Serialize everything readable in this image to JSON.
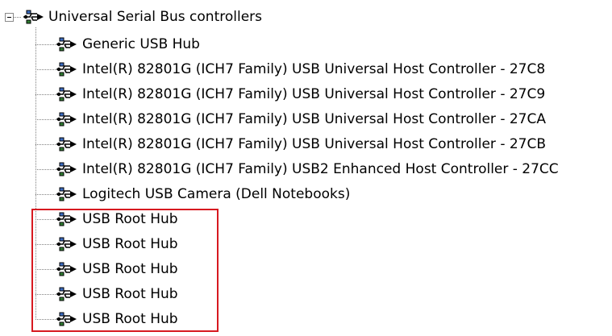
{
  "tree": {
    "root": {
      "label": "Universal Serial Bus controllers",
      "expanded": true,
      "icon": "usb-icon"
    },
    "children": [
      {
        "label": "Generic USB Hub",
        "icon": "usb-icon"
      },
      {
        "label": "Intel(R) 82801G (ICH7 Family) USB Universal Host Controller - 27C8",
        "icon": "usb-icon"
      },
      {
        "label": "Intel(R) 82801G (ICH7 Family) USB Universal Host Controller - 27C9",
        "icon": "usb-icon"
      },
      {
        "label": "Intel(R) 82801G (ICH7 Family) USB Universal Host Controller - 27CA",
        "icon": "usb-icon"
      },
      {
        "label": "Intel(R) 82801G (ICH7 Family) USB Universal Host Controller - 27CB",
        "icon": "usb-icon"
      },
      {
        "label": "Intel(R) 82801G (ICH7 Family) USB2 Enhanced Host Controller - 27CC",
        "icon": "usb-icon"
      },
      {
        "label": "Logitech USB Camera (Dell Notebooks)",
        "icon": "usb-icon"
      },
      {
        "label": "USB Root Hub",
        "icon": "usb-icon"
      },
      {
        "label": "USB Root Hub",
        "icon": "usb-icon"
      },
      {
        "label": "USB Root Hub",
        "icon": "usb-icon"
      },
      {
        "label": "USB Root Hub",
        "icon": "usb-icon"
      },
      {
        "label": "USB Root Hub",
        "icon": "usb-icon"
      }
    ]
  },
  "colors": {
    "highlight_border": "#d71920",
    "tree_line": "#808080",
    "text": "#000000",
    "background": "#ffffff"
  }
}
